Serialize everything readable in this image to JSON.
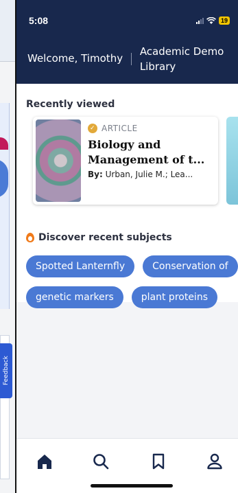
{
  "status_bar": {
    "time": "5:08",
    "battery": "19"
  },
  "header": {
    "welcome": "Welcome, Timothy",
    "library": "Academic Demo Library"
  },
  "side_panel": {
    "feedback_label": "Feedback"
  },
  "recently_viewed": {
    "title": "Recently viewed",
    "card": {
      "type": "ARTICLE",
      "title": "Biology and Management of t...",
      "authors_label": "By:",
      "authors": "Urban, Julie M.; Lea..."
    }
  },
  "discover": {
    "title": "Discover recent subjects",
    "chips_row1": [
      "Spotted Lanternfly",
      "Conservation of"
    ],
    "chips_row2": [
      "genetic markers",
      "plant proteins"
    ]
  },
  "tabbar": {
    "icons": [
      "home-icon",
      "search-icon",
      "bookmark-icon",
      "profile-icon"
    ]
  },
  "colors": {
    "header_bg": "#18284d",
    "chip_bg": "#4a79d4",
    "accent_orange": "#f07a1a"
  }
}
